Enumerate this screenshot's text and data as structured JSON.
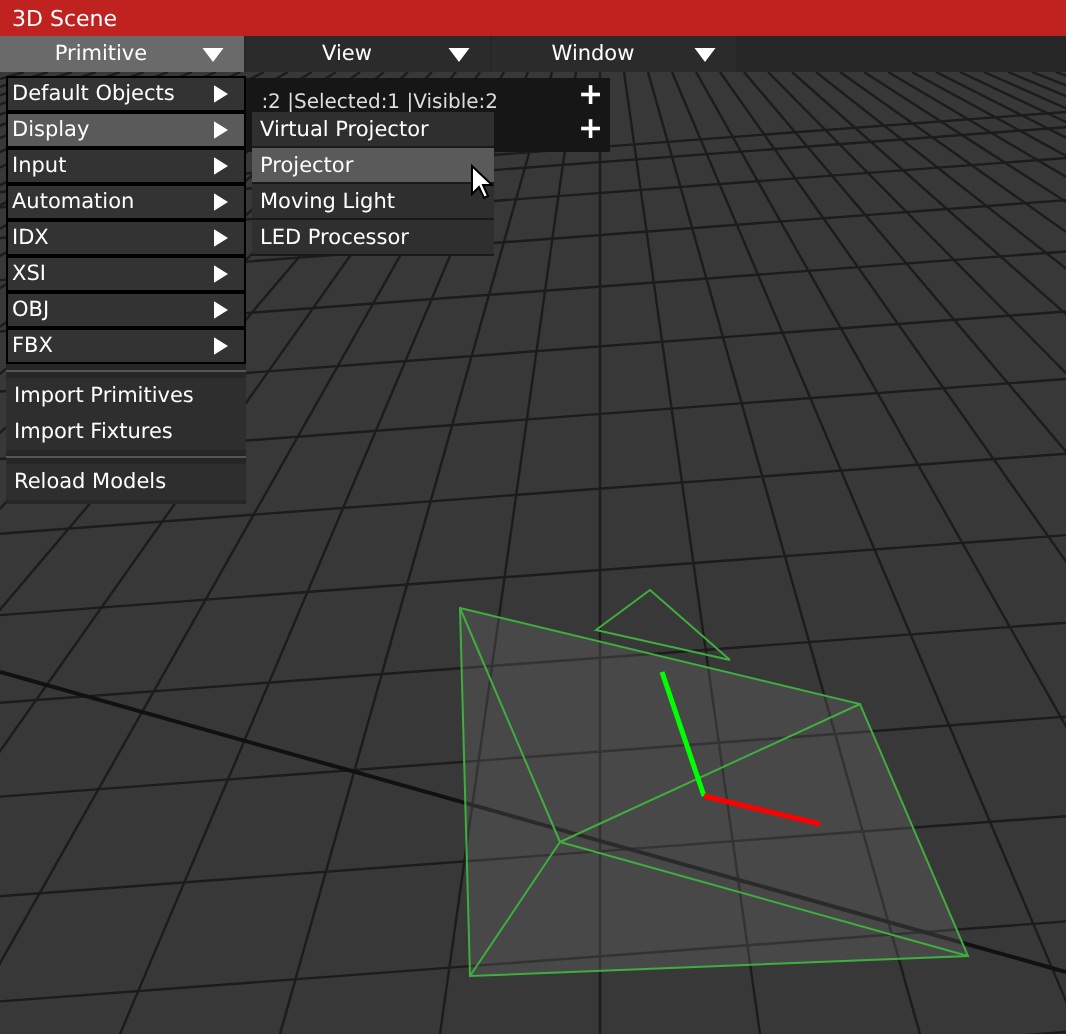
{
  "window": {
    "title": "3D Scene"
  },
  "menubar": [
    {
      "label": "Primitive",
      "selected": true
    },
    {
      "label": "View",
      "selected": false
    },
    {
      "label": "Window",
      "selected": false
    }
  ],
  "stats": {
    "text": ":2 |Selected:1 |Visible:2",
    "buttons": [
      "+",
      "+"
    ]
  },
  "menu": {
    "sections": [
      [
        {
          "label": "Default Objects",
          "kind": "submenu",
          "selected": false
        },
        {
          "label": "Display",
          "kind": "submenu",
          "selected": true
        },
        {
          "label": "Input",
          "kind": "submenu",
          "selected": false
        },
        {
          "label": "Automation",
          "kind": "submenu",
          "selected": false
        },
        {
          "label": "IDX",
          "kind": "submenu",
          "selected": false
        },
        {
          "label": "XSI",
          "kind": "submenu",
          "selected": false
        },
        {
          "label": "OBJ",
          "kind": "submenu",
          "selected": false
        },
        {
          "label": "FBX",
          "kind": "submenu",
          "selected": false
        }
      ],
      [
        {
          "label": "Import Primitives",
          "kind": "action",
          "selected": false
        },
        {
          "label": "Import Fixtures",
          "kind": "action",
          "selected": false
        }
      ],
      [
        {
          "label": "Reload Models",
          "kind": "action",
          "selected": false
        }
      ]
    ]
  },
  "submenu": {
    "items": [
      {
        "label": "Virtual Projector",
        "selected": false
      },
      {
        "label": "Projector",
        "selected": true
      },
      {
        "label": "Moving Light",
        "selected": false
      },
      {
        "label": "LED Processor",
        "selected": false
      }
    ]
  }
}
